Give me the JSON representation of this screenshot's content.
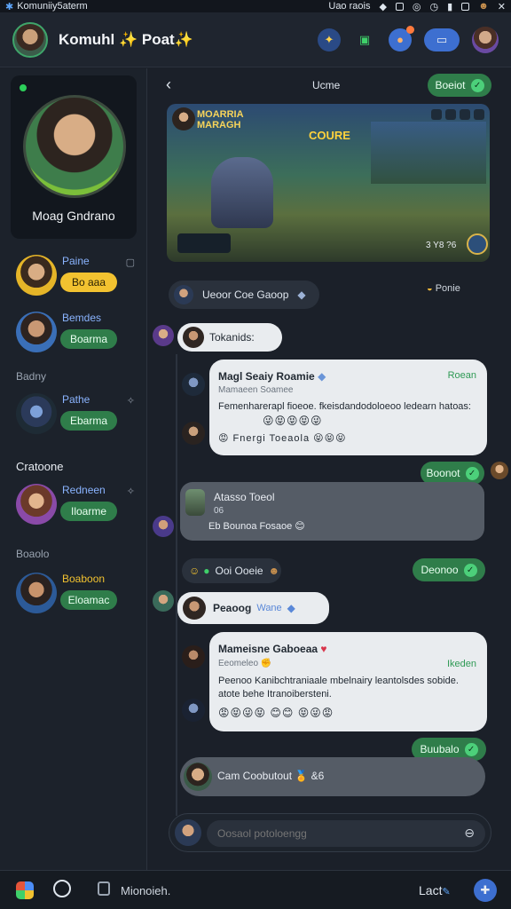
{
  "statusbar": {
    "app": "Komuniiy5aterm",
    "right": "Uao raois"
  },
  "header": {
    "title": "Komuhl ✨ Poat✨"
  },
  "profile": {
    "name": "Moag Gndrano"
  },
  "sidebar": {
    "labels": [
      "Badny",
      "Cratoone",
      "Boaolo"
    ],
    "friends": [
      {
        "name": "Paine",
        "button": "Bo aaa",
        "btn_color": "#f2c230",
        "btn_text": "#2a2205"
      },
      {
        "name": "Bemdes",
        "button": "Boarma",
        "btn_color": "#2f7d4a",
        "btn_text": "#e8fff0"
      },
      {
        "name": "Pathe",
        "button": "Ebarma",
        "btn_color": "#2f7d4a",
        "btn_text": "#e8fff0"
      },
      {
        "name": "Redneen",
        "button": "Iloarme",
        "btn_color": "#2f7d4a",
        "btn_text": "#e8fff0"
      },
      {
        "name": "Boaboon",
        "button": "Eloamac",
        "btn_color": "#2f7d4a",
        "btn_text": "#e8fff0"
      }
    ]
  },
  "topbar": {
    "title": "Ucme",
    "button": "Boeiot"
  },
  "game": {
    "title_line1": "MOARRIA",
    "title_line2": "MARAGH",
    "logo": "COURE",
    "num": "3 Y8 ?6"
  },
  "feed": {
    "pill1": "Ueoor Coe Gaoop",
    "pill1_right": "Ponie",
    "pill2": "Tokanids:",
    "card1": {
      "title": "Magl Seaiy Roamie",
      "tag": "Roean",
      "subtitle": "Mamaeen Soamee",
      "body": "Femenharerapl fioeoe. fkeisdandodoloeoo ledearn hatoas:",
      "emojis1": "😜😝😝😝😜",
      "emojis2": "😡 Fnergi Toeaola 😝😝😝"
    },
    "reply1": "Boonot",
    "gray1": {
      "title": "Atasso Toeol",
      "sub": "06",
      "line": "Eb Bounoa Fosaoe 😊"
    },
    "pill3": "Ooi Ooeie",
    "reply2": "Deonoo",
    "pill4": "Peaoog",
    "pill4_extra": "Wane",
    "card2": {
      "title": "Mameisne Gaboeaa",
      "tag": "Ikeden",
      "subtitle": "Eeomeleo",
      "body": "Peenoo Kanibchtraniaale mbelnairy leantolsdes sobide. atote behe Itranoibersteni.",
      "emojis": "😡😝😜😝 😊😊 😝😜😡"
    },
    "reply3": "Buubalo",
    "gray2": "Cam Coobutout 🏅 &6"
  },
  "composer": {
    "placeholder": "Oosaol potoloengg"
  },
  "bottom": {
    "label": "Mionoieh.",
    "right": "Lact"
  }
}
